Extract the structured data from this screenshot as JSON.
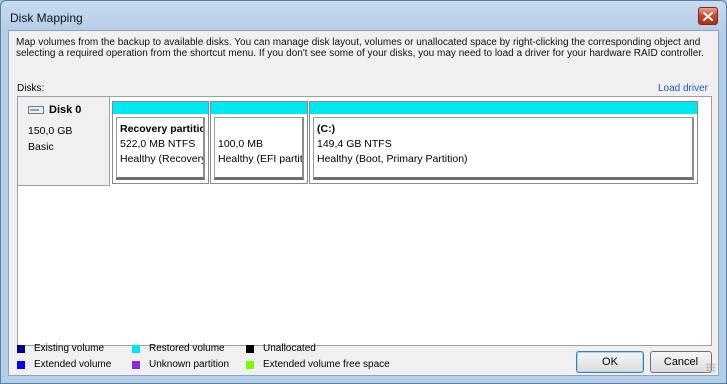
{
  "window": {
    "title": "Disk Mapping"
  },
  "description": "Map volumes from the backup to available disks. You can manage disk layout, volumes or unallocated space by right-clicking the corresponding object and selecting a required operation from the shortcut menu. If you don't see some of your disks, you may need to load a driver for your hardware RAID controller.",
  "disks_label": "Disks:",
  "load_driver_link": "Load driver",
  "disk": {
    "name": "Disk 0",
    "size": "150,0 GB",
    "type": "Basic",
    "icon": "disk-drive-icon"
  },
  "partitions": [
    {
      "name": "Recovery partition",
      "size": "522,0 MB NTFS",
      "status": "Healthy (Recovery Partition)",
      "bar_color": "#00e8f0"
    },
    {
      "name": "",
      "size": "100,0 MB",
      "status": "Healthy (EFI partition)",
      "bar_color": "#00e8f0"
    },
    {
      "name": "(C:)",
      "size": "149,4 GB NTFS",
      "status": "Healthy (Boot, Primary Partition)",
      "bar_color": "#00e8f0"
    }
  ],
  "legend": [
    [
      {
        "label": "Existing volume",
        "color": "#00008b"
      },
      {
        "label": "Restored volume",
        "color": "#00e8f0"
      },
      {
        "label": "Unallocated",
        "color": "#000000"
      }
    ],
    [
      {
        "label": "Extended volume",
        "color": "#0000ff"
      },
      {
        "label": "Unknown partition",
        "color": "#8a2be2"
      },
      {
        "label": "Extended volume free space",
        "color": "#7cfc00"
      }
    ]
  ],
  "buttons": {
    "ok": "OK",
    "cancel": "Cancel"
  }
}
